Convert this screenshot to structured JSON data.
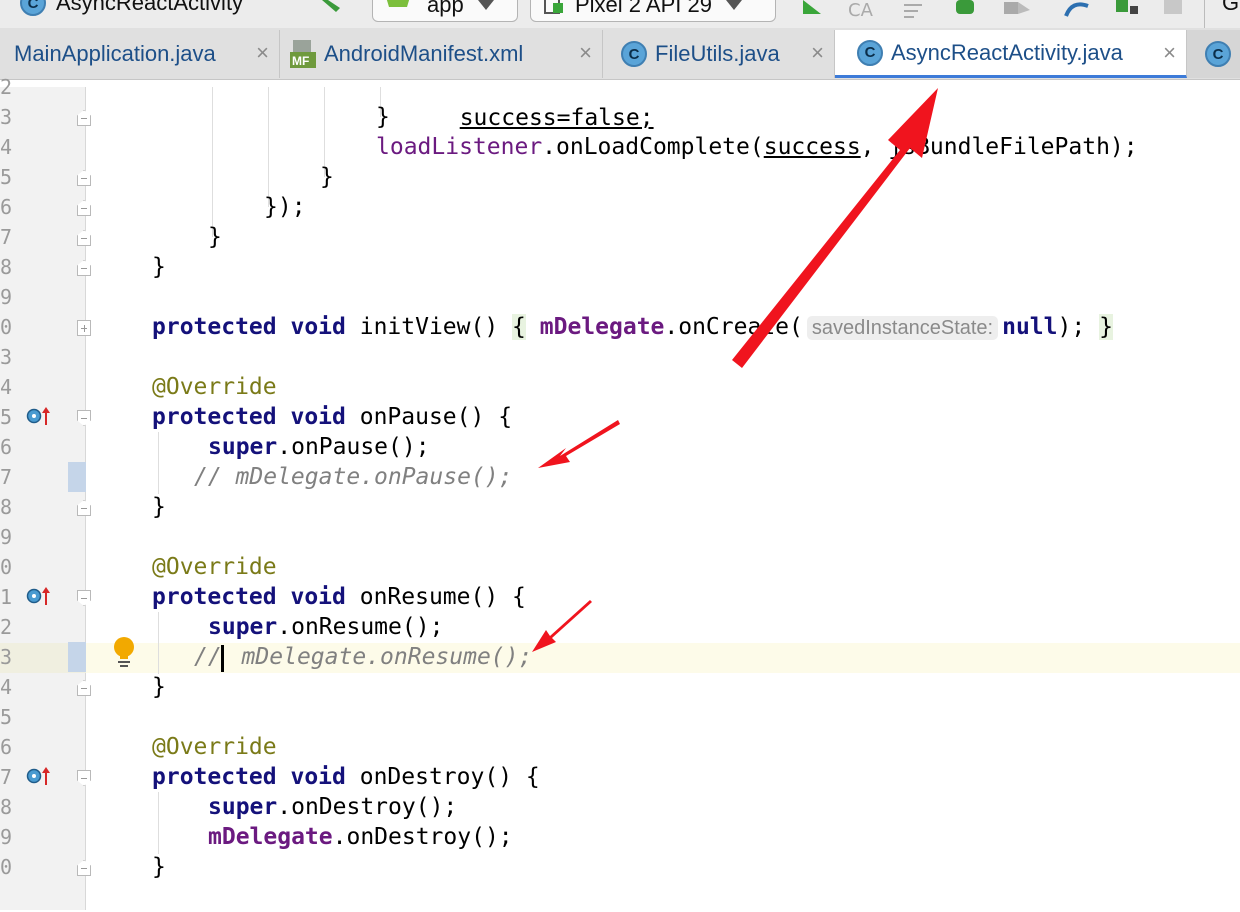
{
  "toolbar": {
    "config_name": "AsyncReactActivity",
    "module_selector": "app",
    "device_selector": "Pixel 2 API 29",
    "right_edge_letter": "G"
  },
  "tabs": [
    {
      "label": "MainApplication.java",
      "icon": "class-icon",
      "active": false
    },
    {
      "label": "AndroidManifest.xml",
      "icon": "manifest-icon",
      "active": false
    },
    {
      "label": "FileUtils.java",
      "icon": "class-icon",
      "active": false
    },
    {
      "label": "AsyncReactActivity.java",
      "icon": "class-icon",
      "active": true
    }
  ],
  "tab_close_glyph": "×",
  "class_icon_letter": "C",
  "manifest_icon_text": "MF",
  "gutter": {
    "line_digits": [
      "2",
      "3",
      "4",
      "5",
      "6",
      "7",
      "8",
      "9",
      "0",
      "3",
      "4",
      "5",
      "6",
      "7",
      "8",
      "9",
      "0",
      "1",
      "2",
      "3",
      "4",
      "5",
      "6",
      "7",
      "8",
      "9",
      "0",
      ""
    ]
  },
  "editor": {
    "line_2": {
      "text": "success=false;"
    },
    "line_3": {
      "text": "}"
    },
    "line_4": {
      "obj": "loadListener",
      "call": ".onLoadComplete(",
      "arg1": "success",
      "rest": ", jsBundleFilePath);"
    },
    "line_5": {
      "text": "}"
    },
    "line_6": {
      "text": "});"
    },
    "line_7": {
      "text": "}"
    },
    "line_8": {
      "text": "}"
    },
    "line_init": {
      "kw1": "protected",
      "kw2": "void",
      "sig": " initView() ",
      "brace_open": "{",
      "field": "mDelegate",
      "call": ".onCreate(",
      "hint": "savedInstanceState:",
      "null_kw": "null",
      "tail": ");",
      "brace_close": "}"
    },
    "annotation": "@Override",
    "onpause": {
      "kw1": "protected",
      "kw2": "void",
      "sig": " onPause() {",
      "super_kw": "super",
      "super_call": ".onPause();",
      "comment": "// mDelegate.onPause();",
      "close": "}"
    },
    "onresume": {
      "kw1": "protected",
      "kw2": "void",
      "sig": " onResume() {",
      "super_kw": "super",
      "super_call": ".onResume();",
      "comment_slashes": "//",
      "comment_rest": " mDelegate.onResume();",
      "close": "}"
    },
    "ondestroy": {
      "kw1": "protected",
      "kw2": "void",
      "sig": " onDestroy() {",
      "super_kw": "super",
      "super_call": ".onDestroy();",
      "field": "mDelegate",
      "call": ".onDestroy();",
      "close": "}"
    }
  },
  "colors": {
    "keyword": "#14117a",
    "field": "#6b1a80",
    "annotation": "#7a7a18",
    "comment": "#808080",
    "arrow": "#f0141e",
    "current_line": "#fdfbe9",
    "active_tab_underline": "#3d7bd8"
  }
}
